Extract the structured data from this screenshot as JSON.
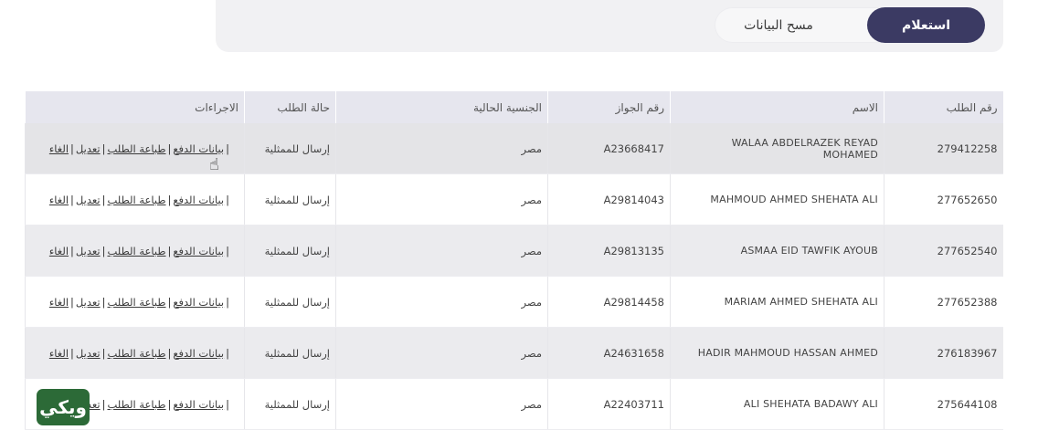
{
  "tabs": {
    "active_label": "استعلام",
    "inactive_label": "مسح البيانات"
  },
  "table": {
    "headers": {
      "request_no": "رقم الطلب",
      "name": "الاسم",
      "passport": "رقم الجواز",
      "nationality": "الجنسية الحالية",
      "status": "حالة الطلب",
      "actions": "الاجراءات"
    },
    "actions": {
      "payment": "بيانات الدفع",
      "print": "طباعة الطلب",
      "edit": "تعديل",
      "cancel": "الغاء",
      "separator": "|"
    },
    "rows": [
      {
        "request_no": "279412258",
        "name": "WALAA ABDELRAZEK REYAD MOHAMED",
        "passport": "A23668417",
        "nationality": "مصر",
        "status": "إرسال للممثلية"
      },
      {
        "request_no": "277652650",
        "name": "MAHMOUD AHMED SHEHATA ALI",
        "passport": "A29814043",
        "nationality": "مصر",
        "status": "إرسال للممثلية"
      },
      {
        "request_no": "277652540",
        "name": "ASMAA EID TAWFIK AYOUB",
        "passport": "A29813135",
        "nationality": "مصر",
        "status": "إرسال للممثلية"
      },
      {
        "request_no": "277652388",
        "name": "MARIAM AHMED SHEHATA ALI",
        "passport": "A29814458",
        "nationality": "مصر",
        "status": "إرسال للممثلية"
      },
      {
        "request_no": "276183967",
        "name": "HADIR MAHMOUD HASSAN AHMED",
        "passport": "A24631658",
        "nationality": "مصر",
        "status": "إرسال للممثلية"
      },
      {
        "request_no": "275644108",
        "name": "ALI SHEHATA BADAWY ALI",
        "passport": "A22403711",
        "nationality": "مصر",
        "status": "إرسال للممثلية"
      }
    ]
  },
  "logo": {
    "text": "ويكي"
  },
  "icons": {
    "cursor": "hand-pointer-icon"
  }
}
